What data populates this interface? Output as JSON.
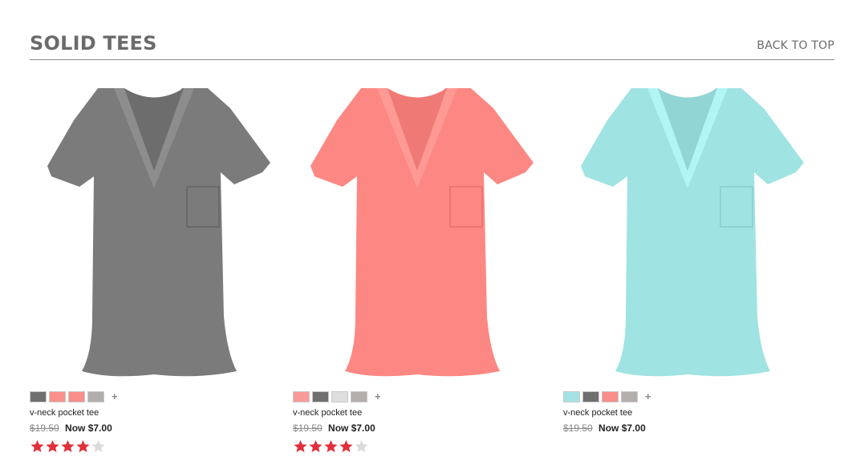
{
  "section": {
    "title": "SOLID TEES",
    "back_to_top": "BACK TO TOP"
  },
  "products": [
    {
      "name": "v-neck pocket tee",
      "old_price": "$19.50",
      "new_price": "Now $7.00",
      "tee_color": "#7b7b7b",
      "swatches": [
        "#6f6f6f",
        "#f9908c",
        "#f98e8a",
        "#b3aeab"
      ],
      "more": "+",
      "rating": 4,
      "rating_max": 5
    },
    {
      "name": "v-neck pocket tee",
      "old_price": "$19.50",
      "new_price": "Now $7.00",
      "tee_color": "#fd8782",
      "swatches": [
        "#f99a98",
        "#6f6f6f",
        "#dedede",
        "#b3aeab"
      ],
      "more": "+",
      "rating": 4,
      "rating_max": 5
    },
    {
      "name": "v-neck pocket tee",
      "old_price": "$19.50",
      "new_price": "Now $7.00",
      "tee_color": "#9fe3e2",
      "swatches": [
        "#a4e3e5",
        "#6f6f6f",
        "#f98e8a",
        "#b3aeab"
      ],
      "more": "+",
      "rating": null,
      "rating_max": 5
    }
  ],
  "colors": {
    "star_filled": "#e0303a",
    "star_empty": "#dadada"
  }
}
